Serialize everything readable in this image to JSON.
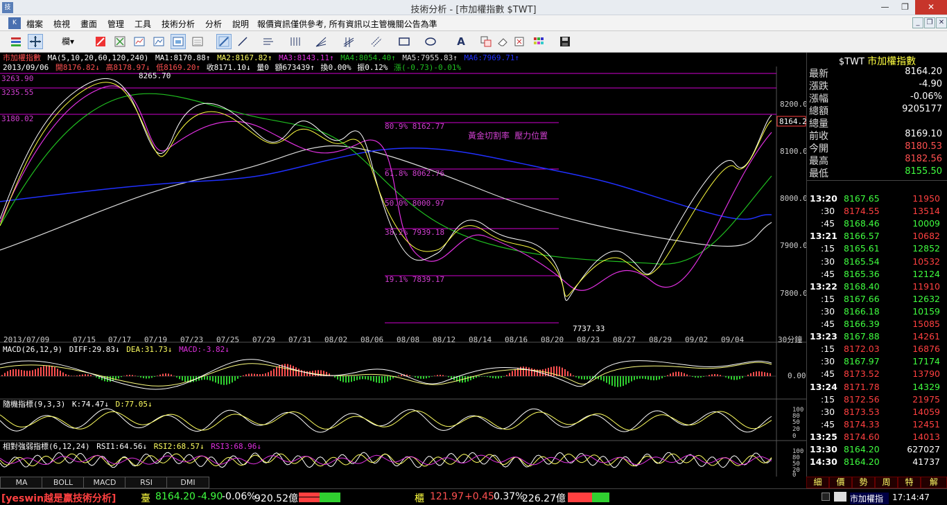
{
  "window": {
    "title": "技術分析 - [市加權指數 $TWT]",
    "min_glyph": "—",
    "max_glyph": "❐",
    "close_glyph": "✕"
  },
  "menu": [
    "檔案",
    "檢視",
    "畫面",
    "管理",
    "工具",
    "技術分析",
    "分析",
    "說明",
    "報價資訊僅供參考, 所有資訊以主管機關公告為準"
  ],
  "toolbar": {
    "period_label": "欄"
  },
  "chart": {
    "ma_line": {
      "head": "市加權指數",
      "params": "MA(5,10,20,60,120,240)",
      "ma1": "MA1:8170.88↑",
      "ma2": "MA2:8167.82↑",
      "ma3": "MA3:8143.11↑",
      "ma4": "MA4:8054.40↑",
      "ma5": "MA5:7955.83↑",
      "ma6": "MA6:7969.71↑"
    },
    "ohlc_line": {
      "date": "2013/09/06",
      "open": "開8176.82↓",
      "high": "高8178.97↓",
      "low": "低8169.20↑",
      "close": "收8171.10↓",
      "vol": "量0",
      "amount": "額673439↑",
      "turnover": "換0.00%",
      "amp": "振0.12%",
      "change": "漲(-0.73)-0.01%"
    },
    "left_levels": [
      "3263.90",
      "3235.55",
      "3180.02"
    ],
    "peak_label": "8265.70",
    "trough_label": "7737.33",
    "fib": [
      "80.9% 8162.77",
      "61.8% 8062.76",
      "50.0% 8000.97",
      "38.2% 7939.18",
      "19.1% 7839.17"
    ],
    "fib_note": "黃金切割率  壓力位置",
    "price_axis": [
      "8200.0",
      "8100.0",
      "8000.0",
      "7900.0",
      "7800.0"
    ],
    "last_price_tag": "8164.2",
    "dates": [
      "2013/07/09",
      "07/15",
      "07/17",
      "07/19",
      "07/23",
      "07/25",
      "07/29",
      "07/31",
      "08/02",
      "08/06",
      "08/08",
      "08/12",
      "08/14",
      "08/16",
      "08/20",
      "08/23",
      "08/27",
      "08/29",
      "09/02",
      "09/04"
    ],
    "period": "30分鐘",
    "macd": {
      "params": "MACD(26,12,9)",
      "diff": "DIFF:29.83↓",
      "dea": "DEA:31.73↓",
      "macd": "MACD:-3.82↓",
      "axis": "0.00"
    },
    "kd": {
      "params": "隨機指標(9,3,3)",
      "k": "K:74.47↓",
      "d": "D:77.05↓",
      "axis": [
        "100",
        "80",
        "50",
        "20",
        "0"
      ]
    },
    "rsi": {
      "params": "相對強弱指標(6,12,24)",
      "rsi1": "RSI1:64.56↓",
      "rsi2": "RSI2:68.57↓",
      "rsi3": "RSI3:68.96↓",
      "axis": [
        "100",
        "80",
        "50",
        "20",
        "0"
      ]
    }
  },
  "bottom_tabs": [
    "MA",
    "BOLL",
    "MACD",
    "RSI",
    "DMI"
  ],
  "quote": {
    "symbol": "$TWT",
    "name": "市加權指數",
    "rows": [
      {
        "label": "最新",
        "value": "8164.20",
        "color": "#ffffff"
      },
      {
        "label": "漲跌",
        "value": "-4.90",
        "color": "#ffffff"
      },
      {
        "label": "漲幅",
        "value": "-0.06%",
        "color": "#ffffff"
      },
      {
        "label": "總額",
        "value": "9205177",
        "color": "#ffffff"
      },
      {
        "label": "總量",
        "value": "",
        "color": "#ffffff"
      },
      {
        "label": "前收",
        "value": "8169.10",
        "color": "#ffffff"
      },
      {
        "label": "今開",
        "value": "8180.53",
        "color": "#ff5050"
      },
      {
        "label": "最高",
        "value": "8182.56",
        "color": "#ff5050"
      },
      {
        "label": "最低",
        "value": "8155.50",
        "color": "#40ff40"
      }
    ]
  },
  "ticks": [
    {
      "time": "13:20",
      "price": "8167.65",
      "vol": "11950",
      "pc": "#40ff40",
      "vc": "#ff4040"
    },
    {
      "time": ":30",
      "price": "8174.55",
      "vol": "13514",
      "pc": "#ff4040",
      "vc": "#ff4040"
    },
    {
      "time": ":45",
      "price": "8168.46",
      "vol": "10009",
      "pc": "#40ff40",
      "vc": "#40ff40"
    },
    {
      "time": "13:21",
      "price": "8166.57",
      "vol": "10682",
      "pc": "#40ff40",
      "vc": "#ff4040"
    },
    {
      "time": ":15",
      "price": "8165.61",
      "vol": "12852",
      "pc": "#40ff40",
      "vc": "#40ff40"
    },
    {
      "time": ":30",
      "price": "8165.54",
      "vol": "10532",
      "pc": "#40ff40",
      "vc": "#ff4040"
    },
    {
      "time": ":45",
      "price": "8165.36",
      "vol": "12124",
      "pc": "#40ff40",
      "vc": "#40ff40"
    },
    {
      "time": "13:22",
      "price": "8168.40",
      "vol": "11910",
      "pc": "#40ff40",
      "vc": "#ff4040"
    },
    {
      "time": ":15",
      "price": "8167.66",
      "vol": "12632",
      "pc": "#40ff40",
      "vc": "#40ff40"
    },
    {
      "time": ":30",
      "price": "8166.18",
      "vol": "10159",
      "pc": "#40ff40",
      "vc": "#40ff40"
    },
    {
      "time": ":45",
      "price": "8166.39",
      "vol": "15085",
      "pc": "#40ff40",
      "vc": "#ff4040"
    },
    {
      "time": "13:23",
      "price": "8167.88",
      "vol": "14261",
      "pc": "#40ff40",
      "vc": "#ff4040"
    },
    {
      "time": ":15",
      "price": "8172.03",
      "vol": "16876",
      "pc": "#ff4040",
      "vc": "#ff4040"
    },
    {
      "time": ":30",
      "price": "8167.97",
      "vol": "17174",
      "pc": "#40ff40",
      "vc": "#40ff40"
    },
    {
      "time": ":45",
      "price": "8173.52",
      "vol": "13790",
      "pc": "#ff4040",
      "vc": "#ff4040"
    },
    {
      "time": "13:24",
      "price": "8171.78",
      "vol": "14329",
      "pc": "#ff4040",
      "vc": "#40ff40"
    },
    {
      "time": ":15",
      "price": "8172.56",
      "vol": "21975",
      "pc": "#ff4040",
      "vc": "#ff4040"
    },
    {
      "time": ":30",
      "price": "8173.53",
      "vol": "14059",
      "pc": "#ff4040",
      "vc": "#ff4040"
    },
    {
      "time": ":45",
      "price": "8174.33",
      "vol": "12451",
      "pc": "#ff4040",
      "vc": "#ff4040"
    },
    {
      "time": "13:25",
      "price": "8174.60",
      "vol": "14013",
      "pc": "#ff4040",
      "vc": "#ff4040"
    },
    {
      "time": "13:30",
      "price": "8164.20",
      "vol": "627027",
      "pc": "#40ff40",
      "vc": "#ffffff"
    },
    {
      "time": "14:30",
      "price": "8164.20",
      "vol": "41737",
      "pc": "#40ff40",
      "vc": "#ffffff"
    }
  ],
  "right_tabs": [
    "細",
    "價",
    "勢",
    "周",
    "特",
    "解"
  ],
  "status": {
    "brand": "[yeswin越是贏技術分析]",
    "idx1_name": "臺",
    "idx1_price": "8164.20",
    "idx1_chg": "-4.90",
    "idx1_pct": "-0.06%",
    "idx1_amt": "920.52億",
    "idx2_name": "櫃",
    "idx2_price": "121.97",
    "idx2_chg": "+0.45",
    "idx2_pct": "0.37%",
    "idx2_amt": "226.27億",
    "ticker": "市加權指",
    "time": "17:14:47"
  }
}
